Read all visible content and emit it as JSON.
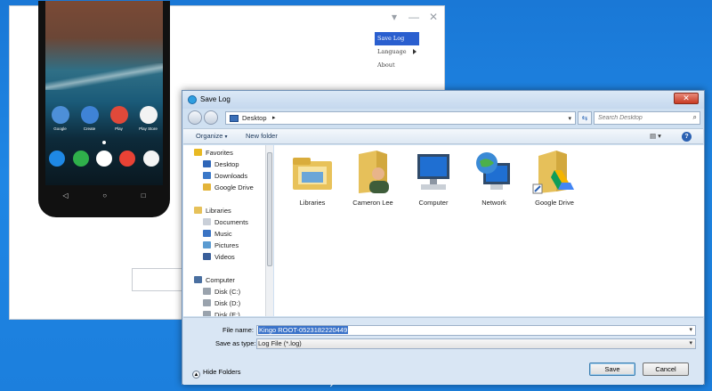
{
  "app": {
    "menu": [
      {
        "label": "Save Log",
        "active": true
      },
      {
        "label": "Language",
        "has_submenu": true
      },
      {
        "label": "About"
      }
    ],
    "controls": {
      "dropdown_icon": "triangle-down-icon",
      "minimize_icon": "minimize-icon",
      "close_icon": "close-icon"
    },
    "phone": {
      "apps": [
        {
          "label": "Google",
          "color": "#4d8fd8"
        },
        {
          "label": "Create",
          "color": "#3f83d6"
        },
        {
          "label": "Play",
          "color": "#e0493a"
        },
        {
          "label": "Play Store",
          "color": "#f3f3f3"
        }
      ],
      "dock": [
        {
          "icon": "phone-icon",
          "color": "#1e88e5"
        },
        {
          "icon": "hangouts-icon",
          "color": "#2fb04b"
        },
        {
          "icon": "app-drawer-icon",
          "color": "#ffffff"
        },
        {
          "icon": "chrome-icon",
          "color": "#e94235"
        },
        {
          "icon": "photos-icon",
          "color": "#f4f4f4"
        }
      ],
      "nav": [
        "back-icon",
        "home-icon",
        "recents-icon"
      ]
    }
  },
  "dialog": {
    "title": "Save Log",
    "close_label": "✕",
    "address": {
      "location": "Desktop",
      "separator": "▸"
    },
    "search": {
      "placeholder": "Search Desktop"
    },
    "toolbar": {
      "organize_label": "Organize",
      "new_folder_label": "New folder"
    },
    "nav_pane": [
      {
        "label": "Favorites",
        "indent": 0,
        "icon": "star-icon",
        "color": "#e8b923"
      },
      {
        "label": "Desktop",
        "indent": 1,
        "icon": "desktop-icon",
        "color": "#2f66b8"
      },
      {
        "label": "Downloads",
        "indent": 1,
        "icon": "downloads-icon",
        "color": "#3a78c8"
      },
      {
        "label": "Google Drive",
        "indent": 1,
        "icon": "google-drive-icon",
        "color": "#e3b43a"
      },
      {
        "label": "Libraries",
        "indent": 0,
        "icon": "libraries-icon",
        "color": "#e6c15a"
      },
      {
        "label": "Documents",
        "indent": 1,
        "icon": "documents-icon",
        "color": "#c9cfd8"
      },
      {
        "label": "Music",
        "indent": 1,
        "icon": "music-icon",
        "color": "#3b74c4"
      },
      {
        "label": "Pictures",
        "indent": 1,
        "icon": "pictures-icon",
        "color": "#5b9bd1"
      },
      {
        "label": "Videos",
        "indent": 1,
        "icon": "videos-icon",
        "color": "#3a5f9a"
      },
      {
        "label": "Computer",
        "indent": 0,
        "icon": "computer-icon",
        "color": "#4a6fa0"
      },
      {
        "label": "Disk (C:)",
        "indent": 1,
        "icon": "disk-icon",
        "color": "#9aa3ad"
      },
      {
        "label": "Disk (D:)",
        "indent": 1,
        "icon": "disk-icon",
        "color": "#9aa3ad"
      },
      {
        "label": "Disk (E:)",
        "indent": 1,
        "icon": "disk-icon",
        "color": "#9aa3ad"
      }
    ],
    "files": [
      {
        "label": "Libraries",
        "icon": "libraries-folder-icon"
      },
      {
        "label": "Cameron Lee",
        "icon": "user-folder-icon"
      },
      {
        "label": "Computer",
        "icon": "computer-icon"
      },
      {
        "label": "Network",
        "icon": "network-icon"
      },
      {
        "label": "Google Drive",
        "icon": "google-drive-folder-icon"
      }
    ],
    "file_name": {
      "label": "File name:",
      "value": "Kingo ROOT-0523182220449"
    },
    "save_as_type": {
      "label": "Save as type:",
      "value": "Log File (*.log)"
    },
    "hide_folders_label": "Hide Folders",
    "save_label": "Save",
    "cancel_label": "Cancel"
  }
}
